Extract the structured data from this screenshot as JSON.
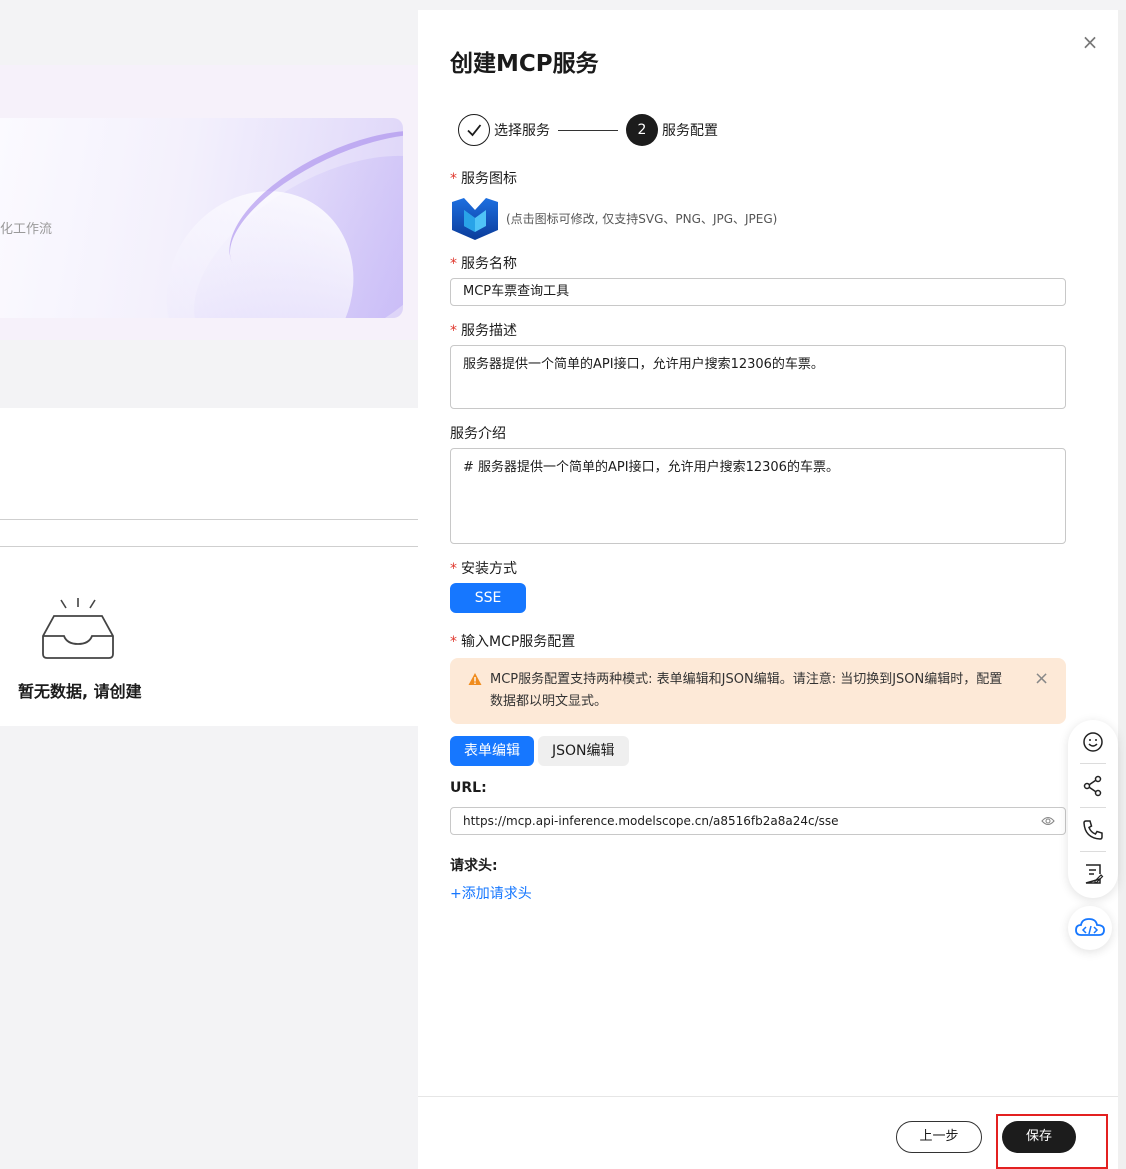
{
  "background": {
    "hero_text": "化工作流",
    "empty_text": "暂无数据, 请创建"
  },
  "drawer": {
    "title": "创建MCP服务",
    "steps": [
      {
        "label": "选择服务",
        "state": "done"
      },
      {
        "number": "2",
        "label": "服务配置",
        "state": "active"
      }
    ],
    "service_icon": {
      "label": "服务图标",
      "hint": "(点击图标可修改, 仅支持SVG、PNG、JPG、JPEG)"
    },
    "service_name": {
      "label": "服务名称",
      "value": "MCP车票查询工具"
    },
    "service_desc": {
      "label": "服务描述",
      "value": "服务器提供一个简单的API接口，允许用户搜索12306的车票。"
    },
    "service_intro": {
      "label": "服务介绍",
      "value": "# 服务器提供一个简单的API接口，允许用户搜索12306的车票。"
    },
    "install": {
      "label": "安装方式",
      "option": "SSE"
    },
    "mcp_config": {
      "label": "输入MCP服务配置",
      "alert": "MCP服务配置支持两种模式: 表单编辑和JSON编辑。请注意: 当切换到JSON编辑时，配置数据都以明文显式。",
      "tabs": [
        "表单编辑",
        "JSON编辑"
      ],
      "url_label": "URL:",
      "url_value": "https://mcp.api-inference.modelscope.cn/a8516fb2a8a24c/sse",
      "headers_label": "请求头:",
      "add_header": "+添加请求头"
    },
    "footer": {
      "prev": "上一步",
      "save": "保存"
    }
  },
  "colors": {
    "primary": "#1677ff",
    "dark": "#1c1c1c",
    "required": "#e0372d",
    "alert_bg": "#fde9d7",
    "alert_icon": "#f08c1e",
    "highlight": "#e32020"
  },
  "icons": [
    "check-icon",
    "close-icon",
    "warning-icon",
    "eye-icon",
    "smile-icon",
    "share-icon",
    "phone-icon",
    "note-icon",
    "cloud-code-icon",
    "empty-inbox-icon",
    "service-logo-icon"
  ]
}
